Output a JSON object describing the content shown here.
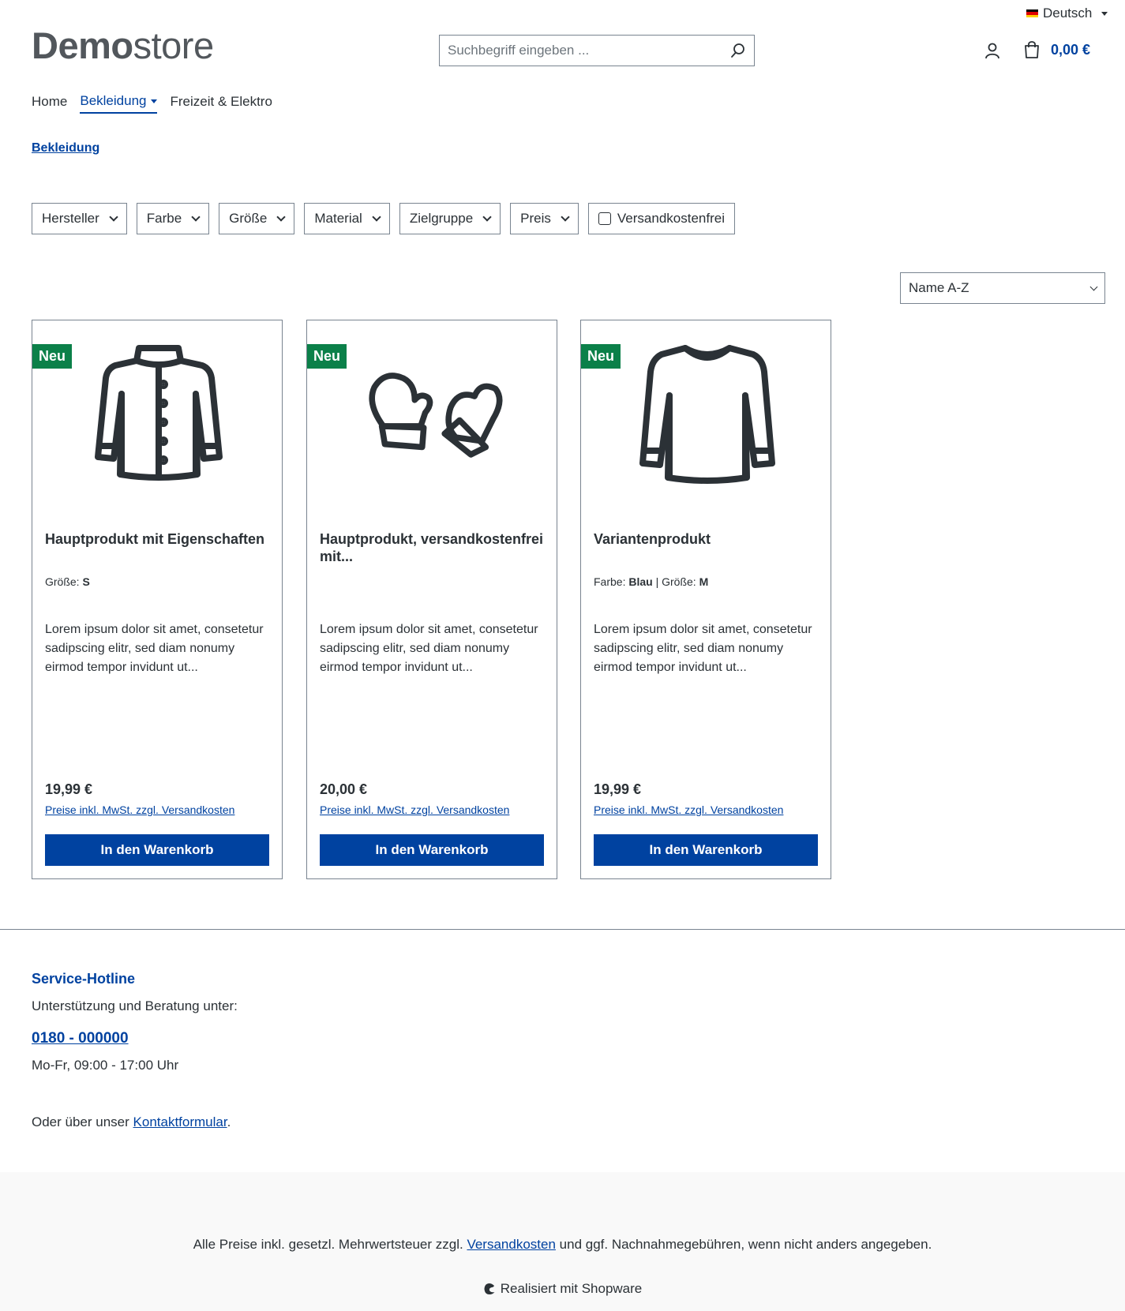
{
  "topbar": {
    "language": "Deutsch"
  },
  "header": {
    "logo_bold": "Demo",
    "logo_light": "store",
    "search_placeholder": "Suchbegriff eingeben ...",
    "cart_total": "0,00 €"
  },
  "nav": {
    "items": [
      {
        "label": "Home"
      },
      {
        "label": "Bekleidung"
      },
      {
        "label": "Freizeit & Elektro"
      }
    ]
  },
  "breadcrumb": "Bekleidung",
  "filters": [
    "Hersteller",
    "Farbe",
    "Größe",
    "Material",
    "Zielgruppe",
    "Preis"
  ],
  "shipping_free_filter": "Versandkostenfrei",
  "sort": {
    "selected": "Name A-Z"
  },
  "products": [
    {
      "badge": "Neu",
      "icon": "jacket-icon",
      "title": "Hauptprodukt mit Eigenschaften",
      "prop1_label": "Größe:",
      "prop1_value": "S",
      "description": "Lorem ipsum dolor sit amet, consetetur sadipscing elitr, sed diam nonumy eirmod tempor invidunt ut...",
      "price": "19,99 €",
      "tax_link": "Preise inkl. MwSt. zzgl. Versandkosten",
      "button": "In den Warenkorb"
    },
    {
      "badge": "Neu",
      "icon": "mittens-icon",
      "title": "Hauptprodukt, versandkostenfrei mit...",
      "description": "Lorem ipsum dolor sit amet, consetetur sadipscing elitr, sed diam nonumy eirmod tempor invidunt ut...",
      "price": "20,00 €",
      "tax_link": "Preise inkl. MwSt. zzgl. Versandkosten",
      "button": "In den Warenkorb"
    },
    {
      "badge": "Neu",
      "icon": "sweater-icon",
      "title": "Variantenprodukt",
      "prop1_label": "Farbe:",
      "prop1_value": "Blau",
      "prop2_label": "Größe:",
      "prop2_value": "M",
      "description": "Lorem ipsum dolor sit amet, consetetur sadipscing elitr, sed diam nonumy eirmod tempor invidunt ut...",
      "price": "19,99 €",
      "tax_link": "Preise inkl. MwSt. zzgl. Versandkosten",
      "button": "In den Warenkorb"
    }
  ],
  "service": {
    "title": "Service-Hotline",
    "subtitle": "Unterstützung und Beratung unter:",
    "phone": "0180 - 000000",
    "hours": "Mo-Fr, 09:00 - 17:00 Uhr",
    "contact_prefix": "Oder über unser",
    "contact_link": "Kontaktformular",
    "contact_suffix": "."
  },
  "footer": {
    "vat_prefix": "Alle Preise inkl. gesetzl. Mehrwertsteuer zzgl.",
    "vat_link": "Versandkosten",
    "vat_suffix": "und ggf. Nachnahmegebühren, wenn nicht anders angegeben.",
    "powered": "Realisiert mit Shopware"
  },
  "colors": {
    "primary": "#0042a0",
    "badge": "#0b8049",
    "text": "#2b3136",
    "border": "#798490",
    "footer_bg": "#f9f9f9"
  }
}
